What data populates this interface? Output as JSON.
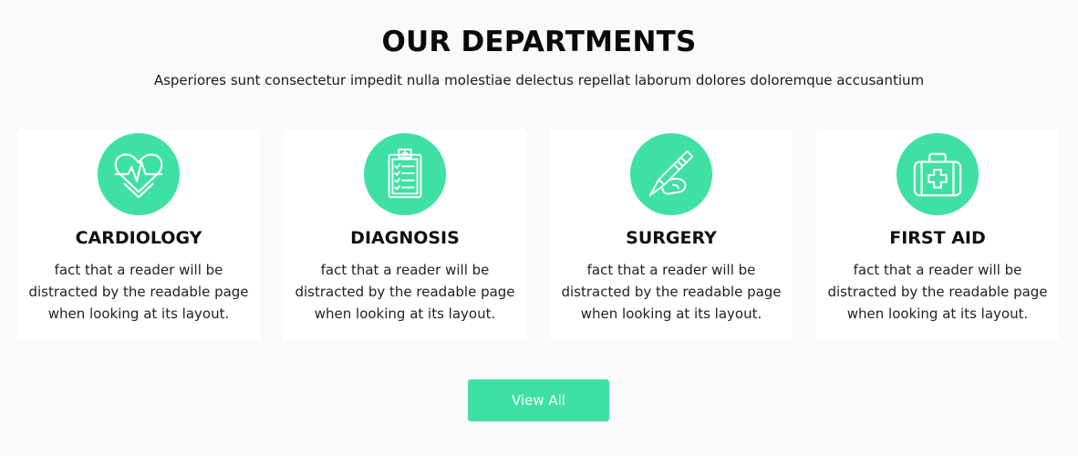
{
  "header": {
    "title": "OUR DEPARTMENTS",
    "subtitle": "Asperiores sunt consectetur impedit nulla molestiae delectus repellat laborum dolores doloremque accusantium"
  },
  "departments": [
    {
      "title": "CARDIOLOGY",
      "description": "fact that a reader will be distracted by the readable page when looking at its layout.",
      "icon": "heartbeat-icon"
    },
    {
      "title": "DIAGNOSIS",
      "description": "fact that a reader will be distracted by the readable page when looking at its layout.",
      "icon": "clipboard-icon"
    },
    {
      "title": "SURGERY",
      "description": "fact that a reader will be distracted by the readable page when looking at its layout.",
      "icon": "scalpel-icon"
    },
    {
      "title": "FIRST AID",
      "description": "fact that a reader will be distracted by the readable page when looking at its layout.",
      "icon": "first-aid-kit-icon"
    }
  ],
  "actions": {
    "view_all_label": "View All"
  },
  "colors": {
    "accent": "#3fe0a4",
    "background": "#fafafc",
    "card": "#ffffff"
  }
}
